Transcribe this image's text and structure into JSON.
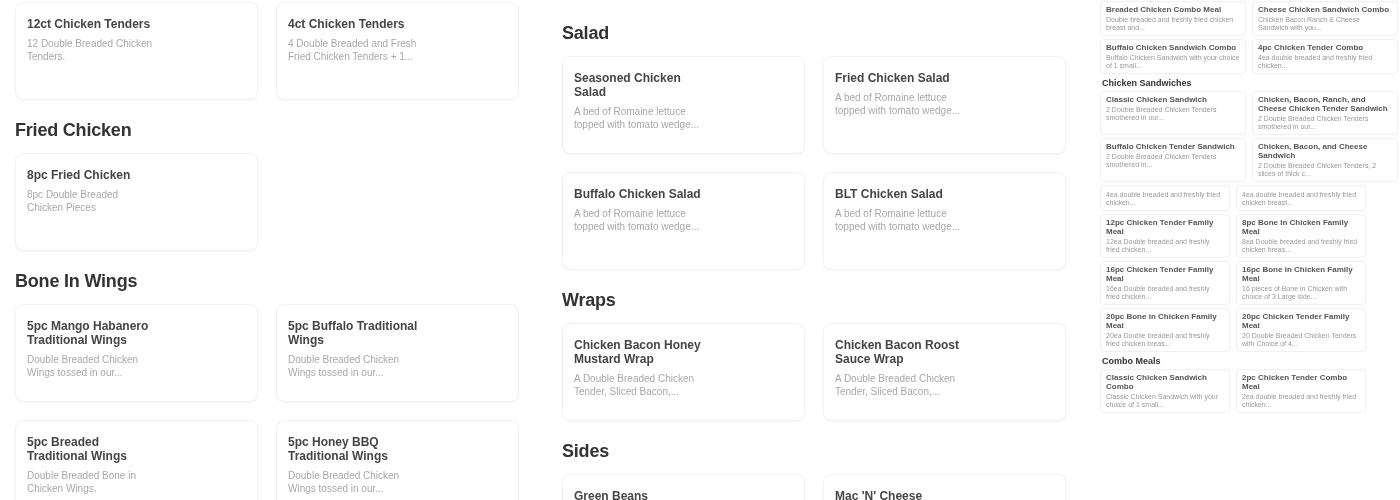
{
  "panels": [
    {
      "kind": "full",
      "sections": [
        {
          "kind": "wide",
          "items": [
            {
              "name": "12ct Chicken Tenders",
              "description": "12 Double Breaded Chicken Tenders."
            },
            {
              "name": "4ct Chicken Tenders",
              "description": "4 Double Breaded and Fresh Fried Chicken Tenders + 1..."
            }
          ]
        },
        {
          "heading": "Fried Chicken",
          "kind": "wide",
          "items": [
            {
              "name": "8pc Fried Chicken",
              "description": "8pc Double Breaded Chicken Pieces"
            }
          ]
        },
        {
          "heading": "Bone In Wings",
          "kind": "wide",
          "items": [
            {
              "name": "5pc Mango Habanero Traditional Wings",
              "description": "Double Breaded Chicken Wings tossed in our..."
            },
            {
              "name": "5pc Buffalo Traditional Wings",
              "description": "Double Breaded Chicken Wings tossed in our..."
            },
            {
              "name": "5pc Breaded Traditional Wings",
              "description": "Double Breaded Bone in Chicken Wings."
            },
            {
              "name": "5pc Honey BBQ Traditional Wings",
              "description": "Double Breaded Chicken Wings tossed in our..."
            }
          ]
        }
      ]
    },
    {
      "kind": "full",
      "sections": [
        {
          "heading": "Salad",
          "kind": "wide",
          "items": [
            {
              "name": "Seasoned Chicken Salad",
              "description": "A bed of Romaine lettuce topped with tomato wedge..."
            },
            {
              "name": "Fried Chicken Salad",
              "description": "A bed of Romaine lettuce topped with tomato wedge..."
            },
            {
              "name": "Buffalo Chicken Salad",
              "description": "A bed of Romaine lettuce topped with tomato wedge..."
            },
            {
              "name": "BLT Chicken Salad",
              "description": "A bed of Romaine lettuce topped with tomato wedge..."
            }
          ]
        },
        {
          "heading": "Wraps",
          "kind": "wide",
          "items": [
            {
              "name": "Chicken Bacon Honey Mustard Wrap",
              "description": "A Double Breaded Chicken Tender, Sliced Bacon,..."
            },
            {
              "name": "Chicken Bacon Roost Sauce Wrap",
              "description": "A Double Breaded Chicken Tender, Sliced Bacon,..."
            }
          ]
        },
        {
          "heading": "Sides",
          "kind": "wide",
          "items": [
            {
              "name": "Green Beans"
            },
            {
              "name": "Mac 'N' Cheese"
            }
          ]
        }
      ]
    },
    {
      "kind": "thumbnail",
      "sections": [
        {
          "kind": "wide",
          "items": [
            {
              "name": "Breaded Chicken Combo Meal",
              "description": "Double breaded and freshly fried chicken breast and..."
            },
            {
              "name": "Cheese Chicken Sandwich Combo",
              "description": "Chicken Bacon Ranch & Cheese Sandwich with you..."
            },
            {
              "name": "Buffalo Chicken Sandwich Combo",
              "description": "Buffalo Chicken Sandwich with your choice of 1 small..."
            },
            {
              "name": "4pc Chicken Tender Combo",
              "description": "4ea double breaded and freshly fried chicken..."
            }
          ]
        },
        {
          "heading": "Chicken Sandwiches",
          "kind": "wide",
          "items": [
            {
              "name": "Classic Chicken Sandwich",
              "description": "2 Double Breaded Chicken Tenders smothered in our..."
            },
            {
              "name": "Chicken, Bacon, Ranch, and Cheese Chicken Tender Sandwich",
              "description": "2 Double Breaded Chicken Tenders smothered in our..."
            },
            {
              "name": "Buffalo Chicken Tender Sandwich",
              "description": "2 Double Breaded Chicken Tenders smothered in..."
            },
            {
              "name": "Chicken, Bacon, and Cheese Sandwich",
              "description": "2 Double Breaded Chicken Tenders, 2 slices of thick c..."
            }
          ]
        },
        {
          "kind": "compact",
          "items": [
            {
              "description": "4ea double breaded and freshly fried chicken..."
            },
            {
              "description": "4ea double breaded and freshly fried chicken breast..."
            }
          ]
        },
        {
          "kind": "compact",
          "items": [
            {
              "name": "12pc Chicken Tender Family Meal",
              "description": "12ea Double breaded and freshly fried chicken..."
            },
            {
              "name": "8pc Bone In Chicken Family Meal",
              "description": "8ea Double breaded and freshly fried chicken breas..."
            },
            {
              "name": "16pc Chicken Tender Family Meal",
              "description": "16ea Double breaded and freshly fried chicken..."
            },
            {
              "name": "16pc Bone in Chicken Family Meal",
              "description": "16 pieces of Bone in Chicken with choice of 3 Large side..."
            },
            {
              "name": "20pc Bone in Chicken Family Meal",
              "description": "20ea Double breaded and freshly fried chicken breas..."
            },
            {
              "name": "20pc Chicken Tender Family Meal",
              "description": "20 Double Breaded Chicken Tenders with Choice of 4..."
            }
          ]
        },
        {
          "heading": "Combo Meals",
          "kind": "compact",
          "items": [
            {
              "name": "Classic Chicken Sandwich Combo",
              "description": "Classic Chicken Sandwich with your choice of 1 small..."
            },
            {
              "name": "2pc Chicken Tender Combo Meal",
              "description": "2ea double breaded and freshly fried chicken..."
            }
          ]
        }
      ]
    }
  ]
}
